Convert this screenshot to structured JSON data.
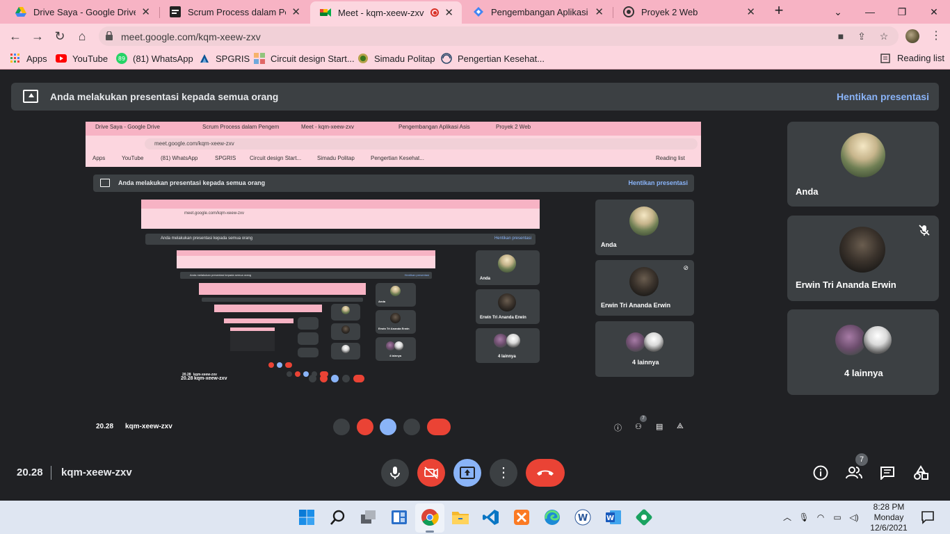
{
  "browser": {
    "tabs": [
      {
        "title": "Drive Saya - Google Drive",
        "icon": "google-drive-icon"
      },
      {
        "title": "Scrum Process dalam Pengem",
        "icon": "scrum-icon"
      },
      {
        "title": "Meet - kqm-xeew-zxv",
        "icon": "google-meet-icon",
        "active": true
      },
      {
        "title": "Pengembangan Aplikasi Asis",
        "icon": "diamond-icon"
      },
      {
        "title": "Proyek 2 Web",
        "icon": "github-icon"
      }
    ],
    "url": "meet.google.com/kqm-xeew-zxv",
    "bookmarks": [
      {
        "label": "Apps",
        "icon": "apps-grid-icon"
      },
      {
        "label": "YouTube",
        "icon": "youtube-icon"
      },
      {
        "label": "(81) WhatsApp",
        "icon": "whatsapp-icon"
      },
      {
        "label": "SPGRIS",
        "icon": "spgris-icon"
      },
      {
        "label": "Circuit design Start...",
        "icon": "circuit-icon"
      },
      {
        "label": "Simadu Politap",
        "icon": "simadu-icon"
      },
      {
        "label": "Pengertian Kesehat...",
        "icon": "globe-icon"
      }
    ],
    "reading_list": "Reading list",
    "colors": {
      "tabstrip": "#f7b3c4",
      "toolbar": "#fcd6df"
    }
  },
  "meet": {
    "banner": {
      "message": "Anda melakukan presentasi kepada semua orang",
      "stop_label": "Hentikan presentasi"
    },
    "participants": [
      {
        "name": "Anda",
        "muted": false
      },
      {
        "name": "Erwin Tri Ananda Erwin",
        "muted": true
      },
      {
        "name": "4 lainnya",
        "muted": false
      }
    ],
    "time": "20.28",
    "meeting_code": "kqm-xeew-zxv",
    "people_count": "7",
    "colors": {
      "background": "#202124",
      "tile": "#3c4043",
      "red": "#ea4335",
      "blue": "#8ab4f8"
    }
  },
  "nested": {
    "p1": {
      "tabs": [
        "Drive Saya - Google Drive",
        "Scrum Process dalam Pengem",
        "Meet - kqm-xeew-zxv",
        "Pengembangan Aplikasi Asis",
        "Proyek 2 Web"
      ],
      "url": "meet.google.com/kqm-xeew-zxv",
      "bookmarks": [
        "Apps",
        "YouTube",
        "(81) WhatsApp",
        "SPGRIS",
        "Circuit design Start...",
        "Simadu Politap",
        "Pengertian Kesehat..."
      ],
      "reading_list": "Reading list",
      "banner": "Anda melakukan presentasi kepada semua orang",
      "stop": "Hentikan presentasi",
      "time": "20.28",
      "code": "kqm-xeew-zxv",
      "people_count": "7",
      "participants": [
        "Anda",
        "Erwin Tri Ananda Erwin",
        "4 lainnya"
      ]
    },
    "p2": {
      "time": "20.28",
      "code": "kqm-xeew-zxv",
      "participants": [
        "Anda",
        "Erwin Tri Ananda Erwin",
        "4 lainnya"
      ],
      "banner": "Anda melakukan presentasi kepada semua orang",
      "stop": "Hentikan presentasi",
      "url": "meet.google.com/kqm-xeew-zxv"
    },
    "p3": {
      "time": "20.28",
      "code": "kqm-xeew-zxv",
      "participants": [
        "Anda",
        "Erwin Tri Ananda Erwin",
        "4 lainnya"
      ],
      "banner": "Anda melakukan presentasi kepada semua orang",
      "stop": "Hentikan presentasi"
    }
  },
  "taskbar": {
    "apps": [
      {
        "name": "Start",
        "icon": "windows-start-icon"
      },
      {
        "name": "Search",
        "icon": "search-icon"
      },
      {
        "name": "Task View",
        "icon": "task-view-icon"
      },
      {
        "name": "Widgets",
        "icon": "widgets-icon"
      },
      {
        "name": "Google Chrome",
        "icon": "chrome-icon"
      },
      {
        "name": "File Explorer",
        "icon": "folder-icon"
      },
      {
        "name": "Visual Studio Code",
        "icon": "vscode-icon"
      },
      {
        "name": "XAMPP",
        "icon": "xampp-icon"
      },
      {
        "name": "Microsoft Edge",
        "icon": "edge-icon"
      },
      {
        "name": "Word Online",
        "icon": "word-online-icon"
      },
      {
        "name": "Microsoft Word",
        "icon": "word-icon"
      },
      {
        "name": "Snipping",
        "icon": "snip-icon"
      }
    ],
    "clock": {
      "time": "8:28 PM",
      "day": "Monday",
      "date": "12/6/2021"
    }
  }
}
